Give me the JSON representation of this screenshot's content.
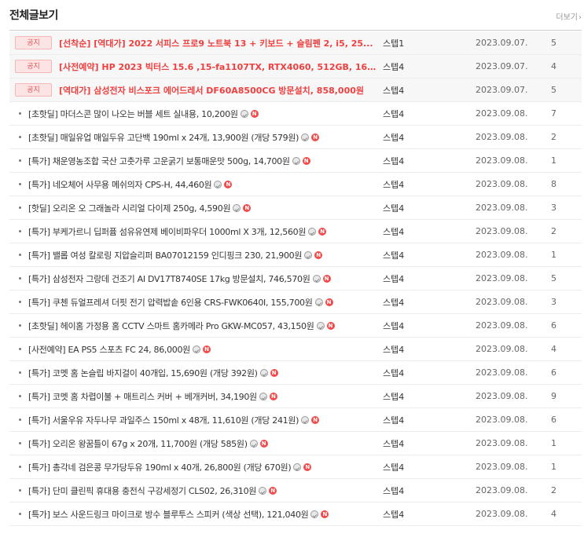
{
  "board": {
    "title": "전체글보기",
    "more_label": "더보기",
    "more_arrow": "›"
  },
  "notices": [
    {
      "badge": "공지",
      "title": "[선착순] [역대가] 2022 서피스 프로9 노트북 13 + 키보드 + 슬림펜 2, i5, 25...",
      "author": "스텝1",
      "date": "2023.09.07.",
      "views": "5"
    },
    {
      "badge": "공지",
      "title": "[사전예약] HP 2023 빅터스 15.6 ,15-fa1107TX, RTX4060, 512GB, 16GB, 99...",
      "author": "스텝4",
      "date": "2023.09.07.",
      "views": "4"
    },
    {
      "badge": "공지",
      "title": "[역대가] 삼성전자 비스포크 에어드레서 DF60A8500CG 방문설치, 858,000원",
      "author": "스텝4",
      "date": "2023.09.07.",
      "views": "5"
    }
  ],
  "posts": [
    {
      "title": "[초핫딜] 마더스콘 많이 나오는 버블 세트 실내용, 10,200원",
      "author": "스텝4",
      "date": "2023.09.08.",
      "views": "7",
      "icons": [
        "image-icon",
        "new-icon"
      ]
    },
    {
      "title": "[초핫딜] 매일유업 매일두유 고단백 190ml x 24개, 13,900원 (개당 579원)",
      "author": "스텝4",
      "date": "2023.09.08.",
      "views": "2",
      "icons": [
        "image-icon",
        "new-icon"
      ]
    },
    {
      "title": "[특가] 채운영농조합 국산 고춧가루 고운굵기 보통매운맛 500g, 14,700원",
      "author": "스텝4",
      "date": "2023.09.08.",
      "views": "1",
      "icons": [
        "image-icon",
        "new-icon"
      ]
    },
    {
      "title": "[특가] 네오체어 사무용 메쉬의자 CPS-H, 44,460원",
      "author": "스텝4",
      "date": "2023.09.08.",
      "views": "8",
      "icons": [
        "image-icon",
        "new-icon"
      ]
    },
    {
      "title": "[핫딜] 오리온 오 그래놀라 시리얼 다이제 250g, 4,590원",
      "author": "스텝4",
      "date": "2023.09.08.",
      "views": "3",
      "icons": [
        "image-icon",
        "new-icon"
      ]
    },
    {
      "title": "[특가] 부케가르니 딥퍼퓸 섬유유연제 베이비파우더 1000ml X 3개, 12,560원",
      "author": "스텝4",
      "date": "2023.09.08.",
      "views": "2",
      "icons": [
        "image-icon",
        "new-icon"
      ]
    },
    {
      "title": "[특가] 밸롭 여성 칼로링 지압슬리퍼 BA07012159 인디핑크 230, 21,900원",
      "author": "스텝4",
      "date": "2023.09.08.",
      "views": "1",
      "icons": [
        "image-icon",
        "new-icon"
      ]
    },
    {
      "title": "[특가] 삼성전자 그랑데 건조기 AI DV17T8740SE 17kg 방문설치, 746,570원",
      "author": "스텝4",
      "date": "2023.09.08.",
      "views": "5",
      "icons": [
        "image-icon",
        "new-icon"
      ]
    },
    {
      "title": "[특가] 쿠첸 듀얼프레셔 더핏 전기 압력밥솥 6인용 CRS-FWK0640I, 155,700원",
      "author": "스텝4",
      "date": "2023.09.08.",
      "views": "3",
      "icons": [
        "image-icon",
        "new-icon"
      ]
    },
    {
      "title": "[초핫딜] 헤이홈 가정용 홈 CCTV 스마트 홈카메라 Pro GKW-MC057, 43,150원",
      "author": "스텝4",
      "date": "2023.09.08.",
      "views": "6",
      "icons": [
        "image-icon",
        "new-icon"
      ]
    },
    {
      "title": "[사전예약] EA PS5 스포츠 FC 24, 86,000원",
      "author": "스텝4",
      "date": "2023.09.08.",
      "views": "4",
      "icons": [
        "image-icon",
        "new-icon"
      ]
    },
    {
      "title": "[특가] 코멧 홈 논슬립 바지걸이 40개입, 15,690원 (개당 392원)",
      "author": "스텝4",
      "date": "2023.09.08.",
      "views": "6",
      "icons": [
        "image-icon",
        "new-icon"
      ]
    },
    {
      "title": "[특가] 코멧 홈 차렵이불 + 매트리스 커버 + 베개커버, 34,190원",
      "author": "스텝4",
      "date": "2023.09.08.",
      "views": "9",
      "icons": [
        "image-icon",
        "new-icon"
      ]
    },
    {
      "title": "[특가] 서울우유 자두나무 과일주스 150ml x 48개, 11,610원 (개당 241원)",
      "author": "스텝4",
      "date": "2023.09.08.",
      "views": "6",
      "icons": [
        "image-icon",
        "new-icon"
      ]
    },
    {
      "title": "[특가] 오리온 왕꿈틀이 67g x 20개, 11,700원 (개당 585원)",
      "author": "스텝4",
      "date": "2023.09.08.",
      "views": "1",
      "icons": [
        "image-icon",
        "new-icon"
      ]
    },
    {
      "title": "[특가] 총각네 검은콩 무가당두유 190ml x 40개, 26,800원 (개당 670원)",
      "author": "스텝4",
      "date": "2023.09.08.",
      "views": "1",
      "icons": [
        "image-icon",
        "new-icon"
      ]
    },
    {
      "title": "[특가] 단미 클린픽 휴대용 충전식 구강세정기 CLS02, 26,310원",
      "author": "스텝4",
      "date": "2023.09.08.",
      "views": "2",
      "icons": [
        "image-icon",
        "new-icon"
      ]
    },
    {
      "title": "[특가] 보스 사운드링크 마이크로 방수 블루투스 스피커 (색상 선택), 121,040원",
      "author": "스텝4",
      "date": "2023.09.08.",
      "views": "4",
      "icons": [
        "image-icon",
        "new-icon"
      ]
    }
  ],
  "colors": {
    "notice_text": "#ef4040",
    "badge_bg": "#fde4e4",
    "new_badge": "#f24a4a"
  }
}
